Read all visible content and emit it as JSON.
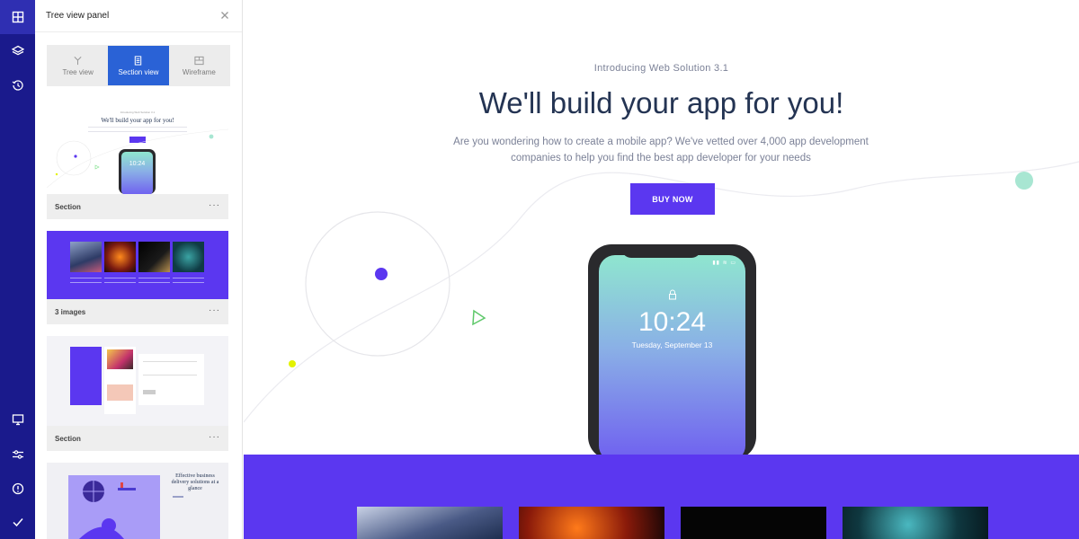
{
  "rail": {
    "top_icons": [
      "layout-icon",
      "layers-icon",
      "history-icon"
    ],
    "bottom_icons": [
      "monitor-icon",
      "sliders-icon",
      "info-icon",
      "check-icon"
    ]
  },
  "panel": {
    "title": "Tree view panel",
    "tabs": [
      {
        "label": "Tree view",
        "icon": "tree-icon",
        "active": false
      },
      {
        "label": "Section view",
        "icon": "section-icon",
        "active": true
      },
      {
        "label": "Wireframe",
        "icon": "wireframe-icon",
        "active": false
      }
    ],
    "cards": [
      {
        "label": "Section",
        "menu": "···",
        "thumb": {
          "intro": "Introducing Web Solution 3.1",
          "headline": "We'll build your app for you!",
          "time": "10:24"
        }
      },
      {
        "label": "3 images",
        "menu": "···"
      },
      {
        "label": "Section",
        "menu": "···"
      },
      {
        "label": "",
        "menu": "",
        "thumb": {
          "headline": "Effective business delivery solutions at a glance"
        }
      }
    ]
  },
  "hero": {
    "intro": "Introducing Web Solution 3.1",
    "headline": "We'll build your app for you!",
    "subtitle": "Are you wondering how to create a mobile app? We've vetted over 4,000 app development companies to help you find the best app developer for your needs",
    "cta_label": "BUY NOW",
    "phone": {
      "time": "10:24",
      "date": "Tuesday, September 13"
    }
  },
  "colors": {
    "rail": "#1a1a8c",
    "accent": "#5b37f0",
    "tab_active": "#2a62d6",
    "headline": "#243453"
  }
}
